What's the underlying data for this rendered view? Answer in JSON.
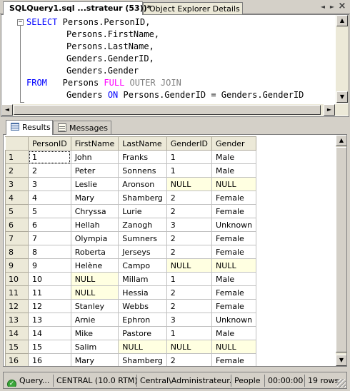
{
  "tabs": {
    "query_tab": "SQLQuery1.sql ...strateur (53))*",
    "object_explorer_tab": "Object Explorer Details",
    "close_glyph": "×",
    "nav_left_glyph": "◄",
    "nav_right_glyph": "►"
  },
  "editor": {
    "collapse_glyph": "−",
    "lines": [
      {
        "kw1": "SELECT",
        "text": "Persons.PersonID,"
      },
      {
        "kw1": "",
        "text": "Persons.FirstName,"
      },
      {
        "kw1": "",
        "text": "Persons.LastName,"
      },
      {
        "kw1": "",
        "text": "Genders.GenderID,"
      },
      {
        "kw1": "",
        "text": "Genders.Gender"
      },
      {
        "kw1": "FROM",
        "text": "Persons"
      },
      {
        "kw1": "",
        "text": "Genders"
      }
    ],
    "join_kw_full": "FULL",
    "join_kw_outer": "OUTER JOIN",
    "on_kw": "ON",
    "on_clause": "Persons.GenderID = Genders.GenderID"
  },
  "result_tabs": {
    "results_label": "Results",
    "messages_label": "Messages"
  },
  "grid": {
    "columns": [
      "PersonID",
      "FirstName",
      "LastName",
      "GenderID",
      "Gender"
    ],
    "rows": [
      [
        "1",
        "1",
        "John",
        "Franks",
        "1",
        "Male"
      ],
      [
        "2",
        "2",
        "Peter",
        "Sonnens",
        "1",
        "Male"
      ],
      [
        "3",
        "3",
        "Leslie",
        "Aronson",
        "NULL",
        "NULL"
      ],
      [
        "4",
        "4",
        "Mary",
        "Shamberg",
        "2",
        "Female"
      ],
      [
        "5",
        "5",
        "Chryssa",
        "Lurie",
        "2",
        "Female"
      ],
      [
        "6",
        "6",
        "Hellah",
        "Zanogh",
        "3",
        "Unknown"
      ],
      [
        "7",
        "7",
        "Olympia",
        "Sumners",
        "2",
        "Female"
      ],
      [
        "8",
        "8",
        "Roberta",
        "Jerseys",
        "2",
        "Female"
      ],
      [
        "9",
        "9",
        "Helène",
        "Campo",
        "NULL",
        "NULL"
      ],
      [
        "10",
        "10",
        "NULL",
        "Millam",
        "1",
        "Male"
      ],
      [
        "11",
        "11",
        "NULL",
        "Hessia",
        "2",
        "Female"
      ],
      [
        "12",
        "12",
        "Stanley",
        "Webbs",
        "2",
        "Female"
      ],
      [
        "13",
        "13",
        "Arnie",
        "Ephron",
        "3",
        "Unknown"
      ],
      [
        "14",
        "14",
        "Mike",
        "Pastore",
        "1",
        "Male"
      ],
      [
        "15",
        "15",
        "Salim",
        "NULL",
        "NULL",
        "NULL"
      ],
      [
        "16",
        "16",
        "Mary",
        "Shamberg",
        "2",
        "Female"
      ]
    ],
    "null_color": "#ffffe1"
  },
  "status": {
    "query": "Query...",
    "server": "CENTRAL (10.0 RTM)",
    "user": "Central\\Administrateur...",
    "database": "People",
    "elapsed": "00:00:00",
    "rows": "19 rows",
    "ok_glyph": "✓"
  }
}
